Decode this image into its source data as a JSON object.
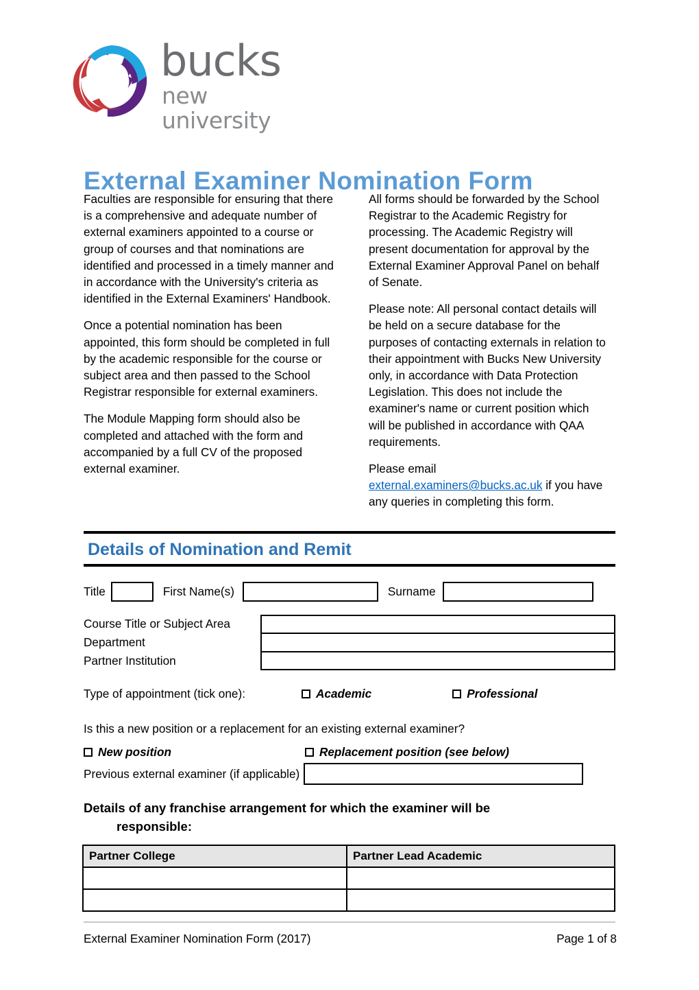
{
  "logo": {
    "wordmark": "bucks",
    "subtitle": "new university",
    "colors": {
      "red": "#c8393c",
      "blue": "#22a7e0",
      "purple": "#5c2483",
      "wordmark_gray": "#6d6e71"
    }
  },
  "title": "External Examiner Nomination Form",
  "title_color": "#5b9bd5",
  "intro": {
    "left": [
      "Faculties are responsible for ensuring that there is a comprehensive and adequate number of external examiners appointed to a course or group of courses and that nominations are identified and processed in a timely manner and in accordance with the University's criteria as identified in the External Examiners' Handbook.",
      "Once a potential nomination has been appointed, this form should be completed in full by the academic responsible for the course or subject area and then passed to the School Registrar responsible for external examiners.",
      "The Module Mapping form should also be completed and attached with the form and accompanied by a full CV of the proposed external examiner."
    ],
    "right_para_1": "All forms should be forwarded by the School Registrar to the Academic Registry for processing. The Academic Registry will present documentation for approval by the External Examiner Approval Panel on behalf of Senate.",
    "right_para_2": "Please note: All personal contact details will be held on a secure database for the purposes of contacting externals in relation to their appointment with Bucks New University only, in accordance with Data Protection Legislation. This does not include the examiner's name or current position which will be published in accordance with QAA requirements.",
    "right_para_3_prefix": "Please email ",
    "email": "external.examiners@bucks.ac.uk",
    "email_color": "#0563c1",
    "right_para_3_suffix": " if you have any queries in completing this form."
  },
  "section": {
    "heading": "Details of Nomination and Remit",
    "heading_color": "#2e74b5"
  },
  "name_row": {
    "title_label": "Title",
    "title_value": "",
    "first_name_label": "First Name(s)",
    "first_name_value": "",
    "surname_label": "Surname",
    "surname_value": ""
  },
  "fields": [
    {
      "label": "Course Title or Subject Area",
      "value": ""
    },
    {
      "label": "Department",
      "value": ""
    },
    {
      "label": "Partner Institution",
      "value": ""
    }
  ],
  "appointment": {
    "question": "Type of appointment (tick one):",
    "options": [
      {
        "label": "Academic",
        "checked": false
      },
      {
        "label": "Professional",
        "checked": false
      }
    ]
  },
  "position": {
    "question": "Is this a new position or a replacement for an existing external examiner?",
    "options": [
      {
        "label": "New position",
        "checked": false
      },
      {
        "label": "Replacement position (see below)",
        "checked": false
      }
    ],
    "previous_label": "Previous external examiner (if applicable)",
    "previous_value": ""
  },
  "franchise": {
    "heading_line1": "Details of any franchise arrangement for which the examiner will be",
    "heading_line2": "responsible:",
    "table": {
      "headers": [
        "Partner College",
        "Partner Lead Academic"
      ],
      "rows": [
        [
          "",
          ""
        ],
        [
          "",
          ""
        ]
      ]
    }
  },
  "footer": {
    "left": "External Examiner Nomination Form (2017)",
    "right": "Page 1 of 8"
  }
}
